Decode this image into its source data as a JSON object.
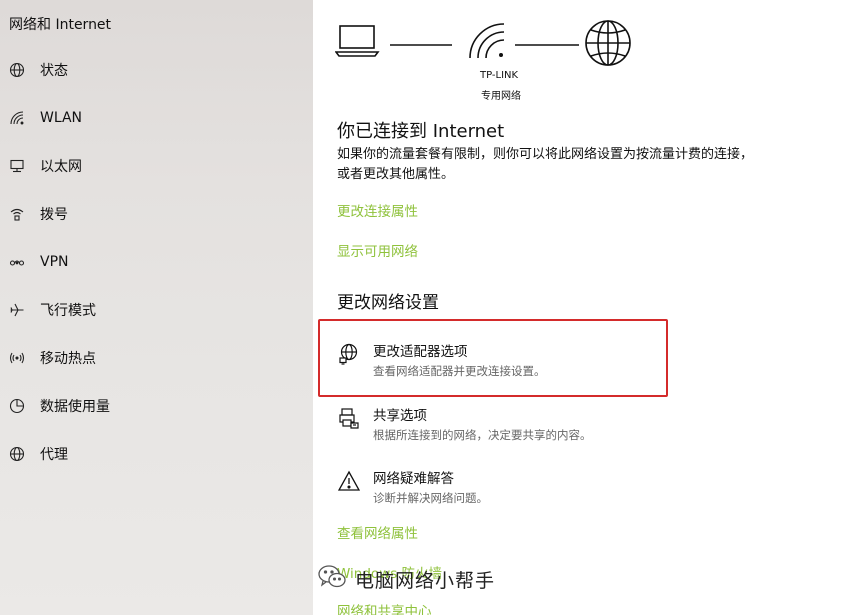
{
  "sidebar": {
    "title": "网络和 Internet",
    "items": [
      {
        "label": "状态",
        "icon": "globe-icon"
      },
      {
        "label": "WLAN",
        "icon": "wifi-icon"
      },
      {
        "label": "以太网",
        "icon": "ethernet-icon"
      },
      {
        "label": "拨号",
        "icon": "dialup-icon"
      },
      {
        "label": "VPN",
        "icon": "vpn-icon"
      },
      {
        "label": "飞行模式",
        "icon": "airplane-icon"
      },
      {
        "label": "移动热点",
        "icon": "hotspot-icon"
      },
      {
        "label": "数据使用量",
        "icon": "data-usage-icon"
      },
      {
        "label": "代理",
        "icon": "globe-icon"
      }
    ]
  },
  "diagram": {
    "network_name": "TP-LINK",
    "network_type": "专用网络"
  },
  "status": {
    "title": "你已连接到 Internet",
    "description": "如果你的流量套餐有限制，则你可以将此网络设置为按流量计费的连接，或者更改其他属性。"
  },
  "links": {
    "change_connection_properties": "更改连接属性",
    "show_available_networks": "显示可用网络",
    "view_network_properties": "查看网络属性",
    "windows_firewall": "Windows 防火墙",
    "network_sharing_center": "网络和共享中心"
  },
  "section": {
    "title": "更改网络设置"
  },
  "options": {
    "adapter": {
      "title": "更改适配器选项",
      "desc": "查看网络适配器并更改连接设置。"
    },
    "sharing": {
      "title": "共享选项",
      "desc": "根据所连接到的网络，决定要共享的内容。"
    },
    "troubleshoot": {
      "title": "网络疑难解答",
      "desc": "诊断并解决网络问题。"
    }
  },
  "watermark": {
    "text": "电脑网络小帮手"
  },
  "colors": {
    "link": "#8fc23c",
    "highlight": "#d42b2b"
  }
}
